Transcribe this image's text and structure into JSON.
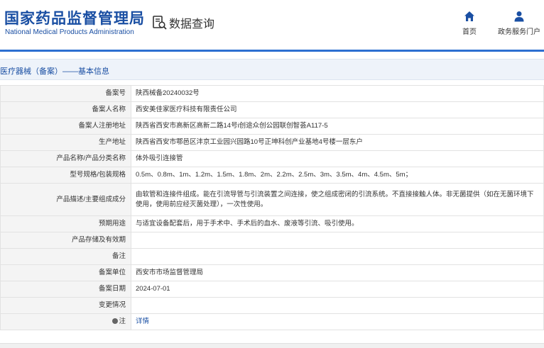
{
  "header": {
    "logo_cn": "国家药品监督管理局",
    "logo_en": "National Medical Products Administration",
    "query_label": "数据查询",
    "nav": {
      "home": "首页",
      "portal": "政务服务门户"
    }
  },
  "section": {
    "title": "医疗器械（备案）——基本信息"
  },
  "rows": [
    {
      "label": "备案号",
      "value": "陕西械备20240032号"
    },
    {
      "label": "备案人名称",
      "value": "西安美佳家医疗科技有限责任公司"
    },
    {
      "label": "备案人注册地址",
      "value": "陕西省西安市高新区高新二路14号i创途众创公园联创智荟A117-5"
    },
    {
      "label": "生产地址",
      "value": "陕西省西安市鄠邑区沣京工业园兴园路10号正坤科创产业基地4号楼一层东户"
    },
    {
      "label": "产品名称/产品分类名称",
      "value": "体外吸引连接管"
    },
    {
      "label": "型号规格/包装规格",
      "value": "0.5m、0.8m、1m、1.2m、1.5m、1.8m、2m、2.2m、2.5m、3m、3.5m、4m、4.5m、5m；"
    },
    {
      "label": "产品描述/主要组成成分",
      "value": "由软管和连接件组成。能在引流导管与引流装置之间连接，使之组成密闭的引流系统。不直接接触人体。非无菌提供（如在无菌环境下使用，使用前应经灭菌处理），一次性使用。"
    },
    {
      "label": "预期用途",
      "value": "与适宜设备配套后，用于手术中、手术后的血水、废液等引流、吸引使用。"
    },
    {
      "label": "产品存储及有效期",
      "value": ""
    },
    {
      "label": "备注",
      "value": ""
    },
    {
      "label": "备案单位",
      "value": "西安市市场监督管理局"
    },
    {
      "label": "备案日期",
      "value": "2024-07-01"
    },
    {
      "label": "变更情况",
      "value": ""
    },
    {
      "label": "注",
      "value": "详情"
    }
  ],
  "colors": {
    "brand": "#1a4fa3",
    "accent_bar": "#2d6fd1",
    "label_bg": "#f4f4f4"
  },
  "icons": {
    "query": "search-document-icon",
    "home": "home-icon",
    "portal": "user-icon",
    "note": "pin-icon"
  }
}
